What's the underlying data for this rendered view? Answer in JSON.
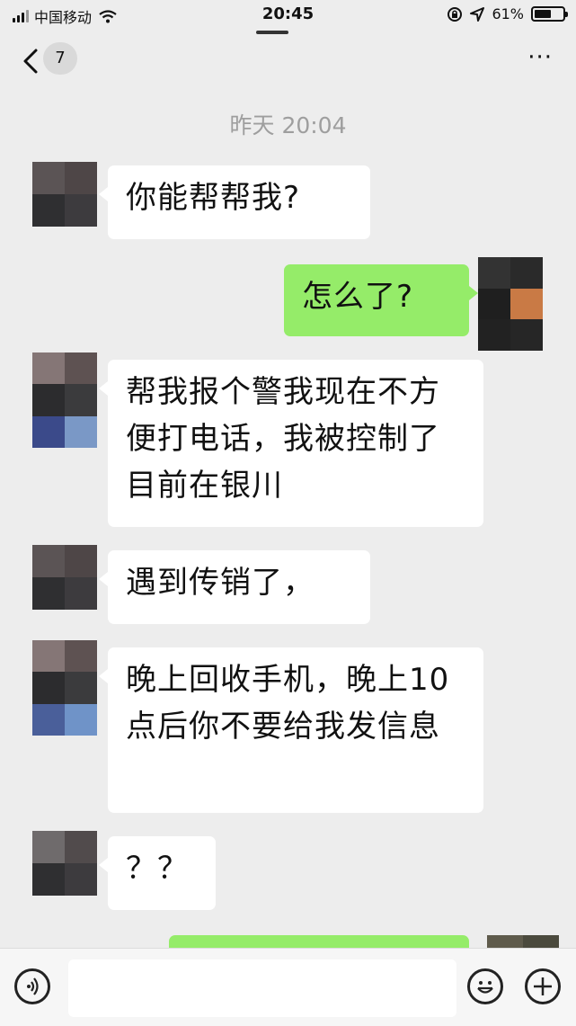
{
  "status_bar": {
    "carrier": "中国移动",
    "time": "20:45",
    "battery": "61%",
    "battery_level": 0.61
  },
  "nav": {
    "unread_count": "7",
    "back_icon": "chevron-left-icon",
    "more_icon": "ellipsis-icon"
  },
  "timestamp": "昨天 20:04",
  "messages": [
    {
      "side": "left",
      "text": "你能帮帮我?"
    },
    {
      "side": "right",
      "text": "怎么了?"
    },
    {
      "side": "left",
      "text": "帮我报个警我现在不方便打电话，我被控制了目前在银川"
    },
    {
      "side": "left",
      "text": "遇到传销了，"
    },
    {
      "side": "left",
      "text": "晚上回收手机，晚上10点后你不要给我发信息"
    },
    {
      "side": "left",
      "text": "？？"
    },
    {
      "side": "right",
      "text": ""
    }
  ],
  "input_bar": {
    "voice_icon": "voice-icon",
    "emoji_icon": "emoji-icon",
    "plus_icon": "plus-icon",
    "input_value": ""
  },
  "colors": {
    "background": "#ededed",
    "bubble_left": "#ffffff",
    "bubble_right": "#95ec69",
    "timestamp": "#9e9e9e"
  }
}
